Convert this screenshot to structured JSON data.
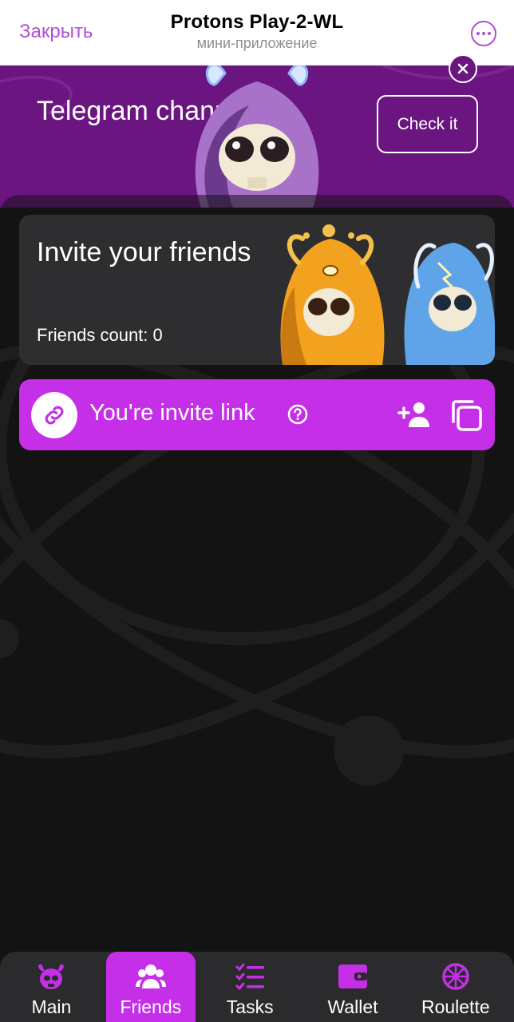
{
  "telegram": {
    "close_label": "Закрыть",
    "title": "Protons Play-2-WL",
    "subtitle": "мини-приложение"
  },
  "banner": {
    "title": "Telegram channel",
    "button_label": "Check it"
  },
  "invite": {
    "title": "Invite your friends",
    "friends_count_label": "Friends count: 0"
  },
  "invite_link": {
    "label": "You're invite link"
  },
  "nav": {
    "items": [
      {
        "label": "Main",
        "icon": "monster-head-icon",
        "active": false
      },
      {
        "label": "Friends",
        "icon": "people-icon",
        "active": true
      },
      {
        "label": "Tasks",
        "icon": "checklist-icon",
        "active": false
      },
      {
        "label": "Wallet",
        "icon": "wallet-icon",
        "active": false
      },
      {
        "label": "Roulette",
        "icon": "roulette-wheel-icon",
        "active": false
      }
    ]
  },
  "colors": {
    "accent": "#c62fe8",
    "banner_bg": "#6a1580",
    "card_bg": "#2e2e30",
    "page_bg": "#121212",
    "telegram_accent": "#b14fd6"
  }
}
